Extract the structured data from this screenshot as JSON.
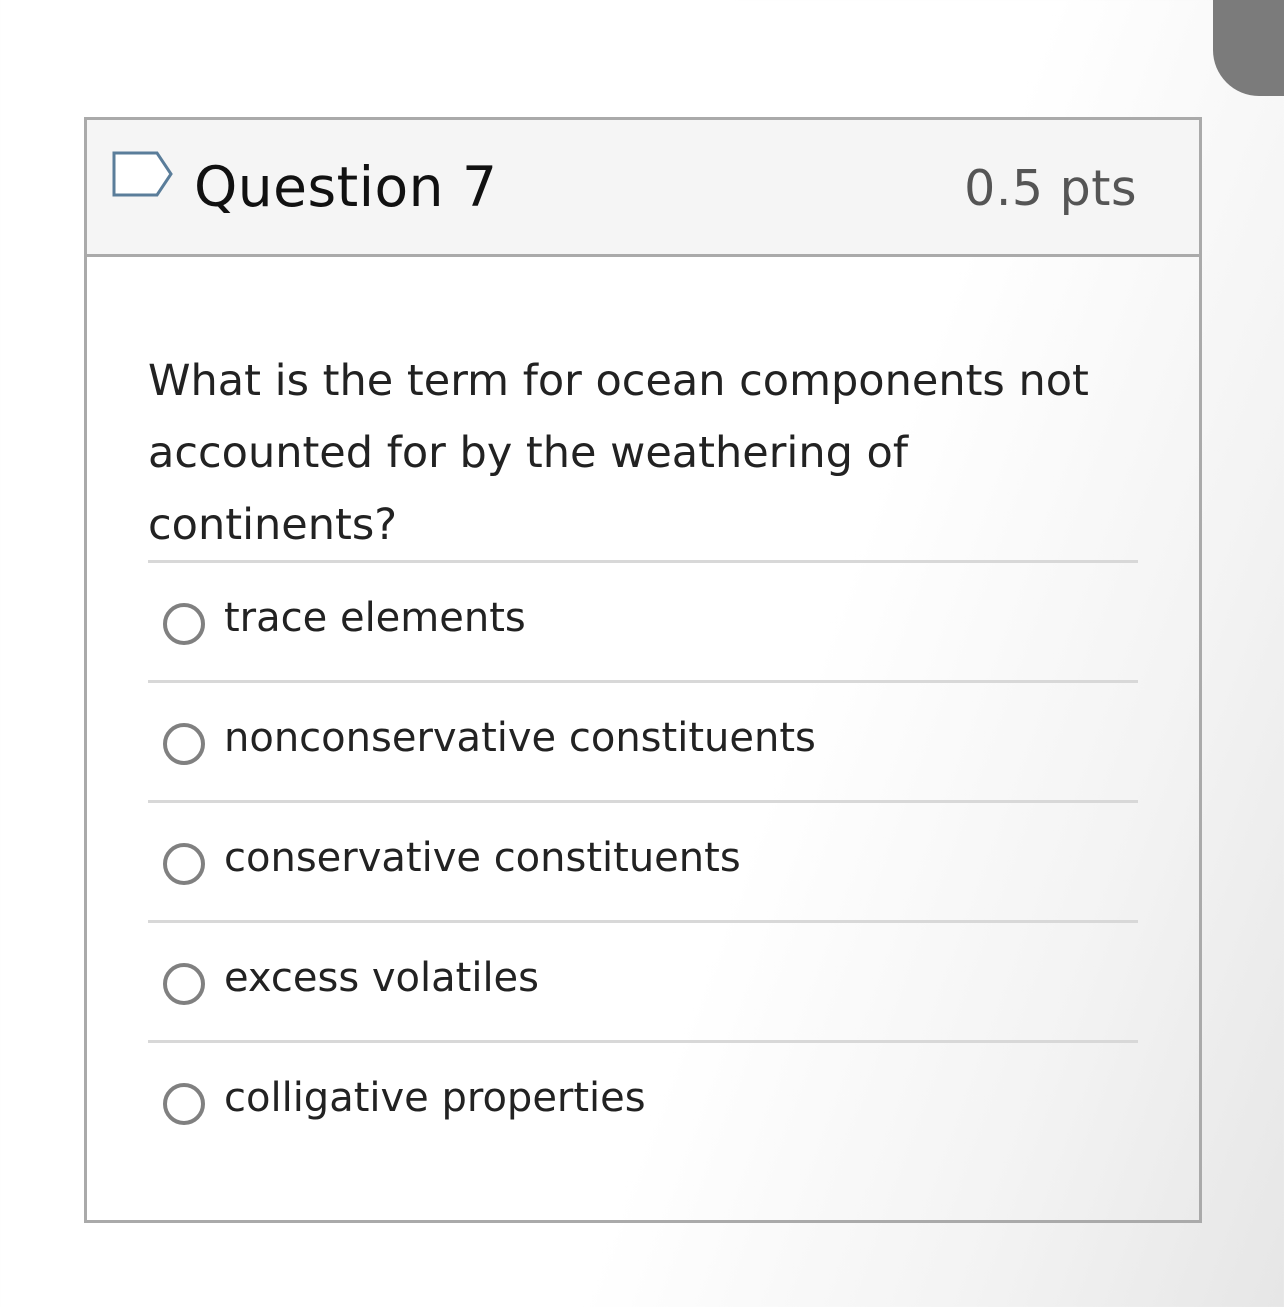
{
  "question": {
    "title": "Question 7",
    "points": "0.5 pts",
    "flag_icon": "flag-outline-icon",
    "text": "What is the term for ocean components not accounted for by the weathering of continents?"
  },
  "answers": [
    {
      "label": "trace elements",
      "selected": false
    },
    {
      "label": "nonconservative constituents",
      "selected": false
    },
    {
      "label": "conservative constituents",
      "selected": false
    },
    {
      "label": "excess volatiles",
      "selected": false
    },
    {
      "label": "colligative properties",
      "selected": false
    }
  ],
  "colors": {
    "border": "#aaaaaa",
    "header_bg": "#f5f5f5",
    "radio": "#808080",
    "divider": "#d8d8d8",
    "flag": "#5a7d9a",
    "corner_tab": "#7b7b7b"
  }
}
